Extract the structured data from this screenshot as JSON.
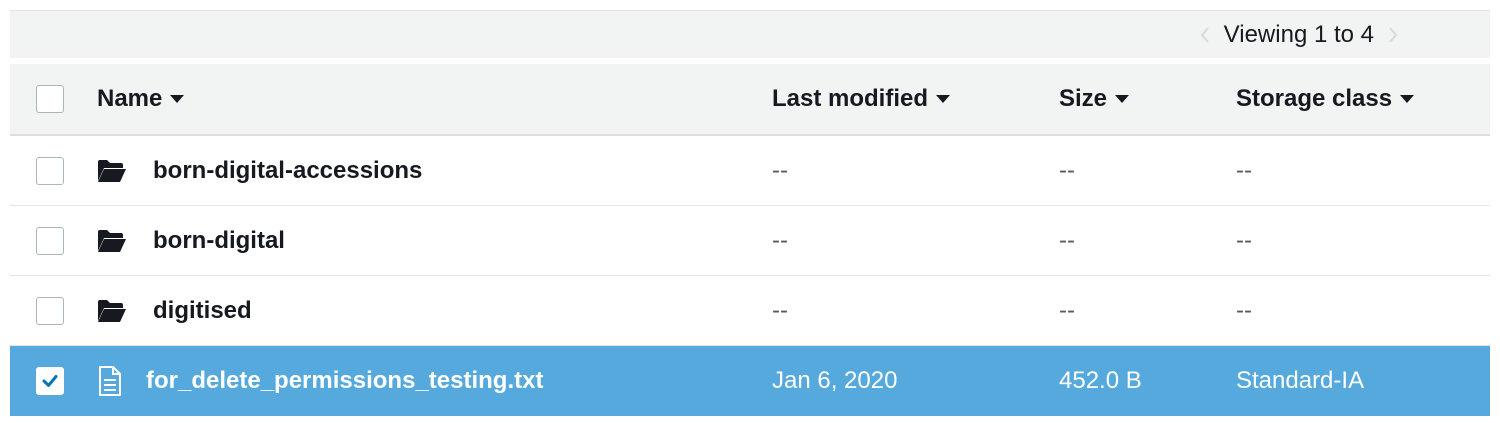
{
  "pager": {
    "text": "Viewing 1 to 4",
    "prev_icon": "chevron-left-icon",
    "next_icon": "chevron-right-icon"
  },
  "columns": {
    "name": "Name",
    "last_modified": "Last modified",
    "size": "Size",
    "storage_class": "Storage class"
  },
  "rows": [
    {
      "type": "folder",
      "icon": "folder-open-icon",
      "name": "born-digital-accessions",
      "last_modified": "--",
      "size": "--",
      "storage_class": "--",
      "selected": false
    },
    {
      "type": "folder",
      "icon": "folder-open-icon",
      "name": "born-digital",
      "last_modified": "--",
      "size": "--",
      "storage_class": "--",
      "selected": false
    },
    {
      "type": "folder",
      "icon": "folder-open-icon",
      "name": "digitised",
      "last_modified": "--",
      "size": "--",
      "storage_class": "--",
      "selected": false
    },
    {
      "type": "file",
      "icon": "file-text-icon",
      "name": "for_delete_permissions_testing.txt",
      "last_modified": "Jan 6, 2020",
      "size": "452.0 B",
      "storage_class": "Standard-IA",
      "selected": true
    }
  ],
  "colors": {
    "header_bg": "#f2f3f3",
    "selected_bg": "#55a9dc",
    "border": "#e4e6e6"
  }
}
